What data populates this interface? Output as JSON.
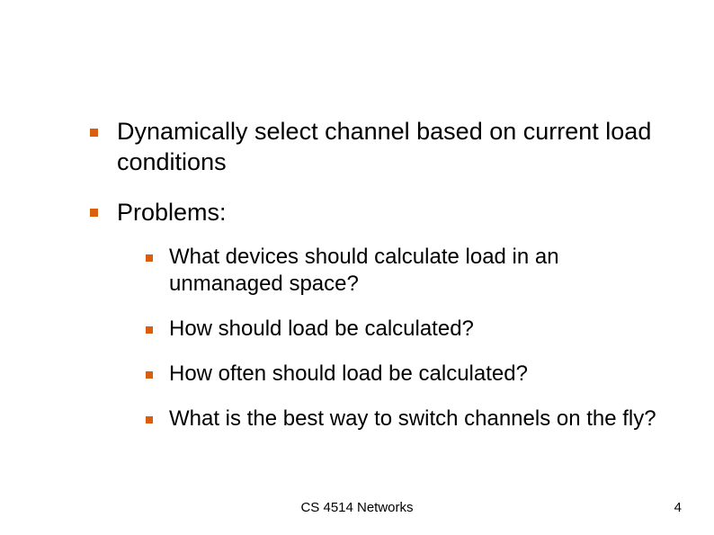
{
  "bullets": [
    {
      "text": "Dynamically select channel based on current load conditions"
    },
    {
      "text": "Problems:",
      "children": [
        "What devices should calculate load in an unmanaged space?",
        "How should load be calculated?",
        "How often should load be calculated?",
        "What is the best way to switch channels on the fly?"
      ]
    }
  ],
  "footer": {
    "center": "CS 4514 Networks",
    "page_number": "4"
  },
  "colors": {
    "bullet": "#d95f0e"
  }
}
